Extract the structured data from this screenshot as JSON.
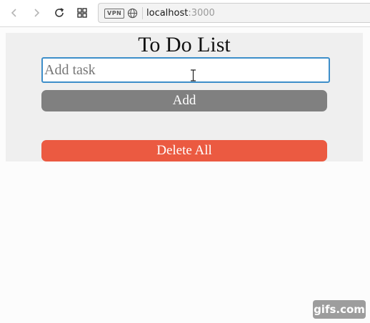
{
  "browser": {
    "url_host": "localhost",
    "url_port": ":3000",
    "vpn_label": "VPN"
  },
  "app": {
    "title": "To Do List",
    "input_placeholder": "Add task",
    "add_label": "Add",
    "delete_all_label": "Delete All"
  },
  "colors": {
    "add_button": "#808080",
    "delete_button": "#eb5a41",
    "input_border": "#3d8ec9",
    "app_background": "#efefef"
  },
  "icons": [
    "back-arrow-icon",
    "forward-arrow-icon",
    "reload-icon",
    "tab-grid-icon",
    "globe-icon",
    "text-cursor-icon"
  ],
  "watermark": "gifs.com"
}
